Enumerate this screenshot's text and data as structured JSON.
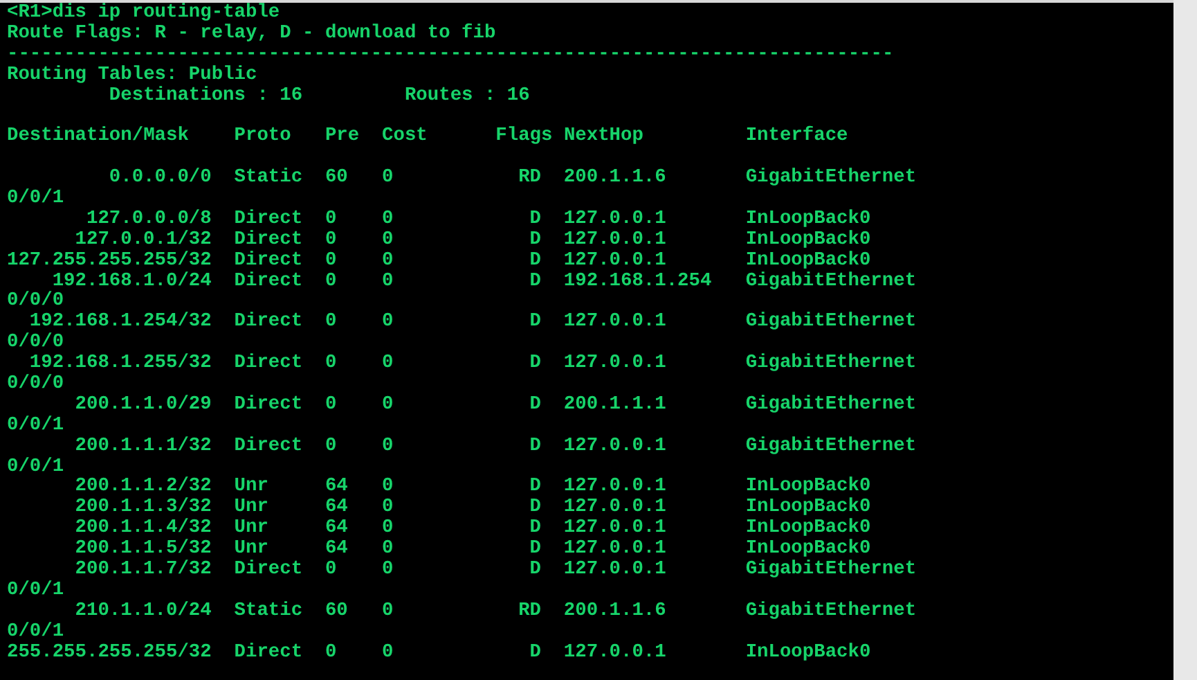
{
  "command": "<R1>dis ip routing-table",
  "flags_legend": "Route Flags: R - relay, D - download to fib",
  "separator": "------------------------------------------------------------------------------",
  "table_title": "Routing Tables: Public",
  "summary": {
    "destinations_label": "Destinations : 16",
    "routes_label": "Routes : 16"
  },
  "columns": [
    "Destination/Mask",
    "Proto",
    "Pre",
    "Cost",
    "Flags",
    "NextHop",
    "Interface"
  ],
  "rows": [
    {
      "destination": "0.0.0.0/0",
      "proto": "Static",
      "pre": "60",
      "cost": "0",
      "flags": "RD",
      "nexthop": "200.1.1.6",
      "interface": "GigabitEthernet",
      "interface_continued": "0/0/1"
    },
    {
      "destination": "127.0.0.0/8",
      "proto": "Direct",
      "pre": "0",
      "cost": "0",
      "flags": "D",
      "nexthop": "127.0.0.1",
      "interface": "InLoopBack0"
    },
    {
      "destination": "127.0.0.1/32",
      "proto": "Direct",
      "pre": "0",
      "cost": "0",
      "flags": "D",
      "nexthop": "127.0.0.1",
      "interface": "InLoopBack0"
    },
    {
      "destination": "127.255.255.255/32",
      "proto": "Direct",
      "pre": "0",
      "cost": "0",
      "flags": "D",
      "nexthop": "127.0.0.1",
      "interface": "InLoopBack0"
    },
    {
      "destination": "192.168.1.0/24",
      "proto": "Direct",
      "pre": "0",
      "cost": "0",
      "flags": "D",
      "nexthop": "192.168.1.254",
      "interface": "GigabitEthernet",
      "interface_continued": "0/0/0"
    },
    {
      "destination": "192.168.1.254/32",
      "proto": "Direct",
      "pre": "0",
      "cost": "0",
      "flags": "D",
      "nexthop": "127.0.0.1",
      "interface": "GigabitEthernet",
      "interface_continued": "0/0/0"
    },
    {
      "destination": "192.168.1.255/32",
      "proto": "Direct",
      "pre": "0",
      "cost": "0",
      "flags": "D",
      "nexthop": "127.0.0.1",
      "interface": "GigabitEthernet",
      "interface_continued": "0/0/0"
    },
    {
      "destination": "200.1.1.0/29",
      "proto": "Direct",
      "pre": "0",
      "cost": "0",
      "flags": "D",
      "nexthop": "200.1.1.1",
      "interface": "GigabitEthernet",
      "interface_continued": "0/0/1"
    },
    {
      "destination": "200.1.1.1/32",
      "proto": "Direct",
      "pre": "0",
      "cost": "0",
      "flags": "D",
      "nexthop": "127.0.0.1",
      "interface": "GigabitEthernet",
      "interface_continued": "0/0/1"
    },
    {
      "destination": "200.1.1.2/32",
      "proto": "Unr",
      "pre": "64",
      "cost": "0",
      "flags": "D",
      "nexthop": "127.0.0.1",
      "interface": "InLoopBack0"
    },
    {
      "destination": "200.1.1.3/32",
      "proto": "Unr",
      "pre": "64",
      "cost": "0",
      "flags": "D",
      "nexthop": "127.0.0.1",
      "interface": "InLoopBack0"
    },
    {
      "destination": "200.1.1.4/32",
      "proto": "Unr",
      "pre": "64",
      "cost": "0",
      "flags": "D",
      "nexthop": "127.0.0.1",
      "interface": "InLoopBack0"
    },
    {
      "destination": "200.1.1.5/32",
      "proto": "Unr",
      "pre": "64",
      "cost": "0",
      "flags": "D",
      "nexthop": "127.0.0.1",
      "interface": "InLoopBack0"
    },
    {
      "destination": "200.1.1.7/32",
      "proto": "Direct",
      "pre": "0",
      "cost": "0",
      "flags": "D",
      "nexthop": "127.0.0.1",
      "interface": "GigabitEthernet",
      "interface_continued": "0/0/1"
    },
    {
      "destination": "210.1.1.0/24",
      "proto": "Static",
      "pre": "60",
      "cost": "0",
      "flags": "RD",
      "nexthop": "200.1.1.6",
      "interface": "GigabitEthernet",
      "interface_continued": "0/0/1"
    },
    {
      "destination": "255.255.255.255/32",
      "proto": "Direct",
      "pre": "0",
      "cost": "0",
      "flags": "D",
      "nexthop": "127.0.0.1",
      "interface": "InLoopBack0"
    }
  ]
}
